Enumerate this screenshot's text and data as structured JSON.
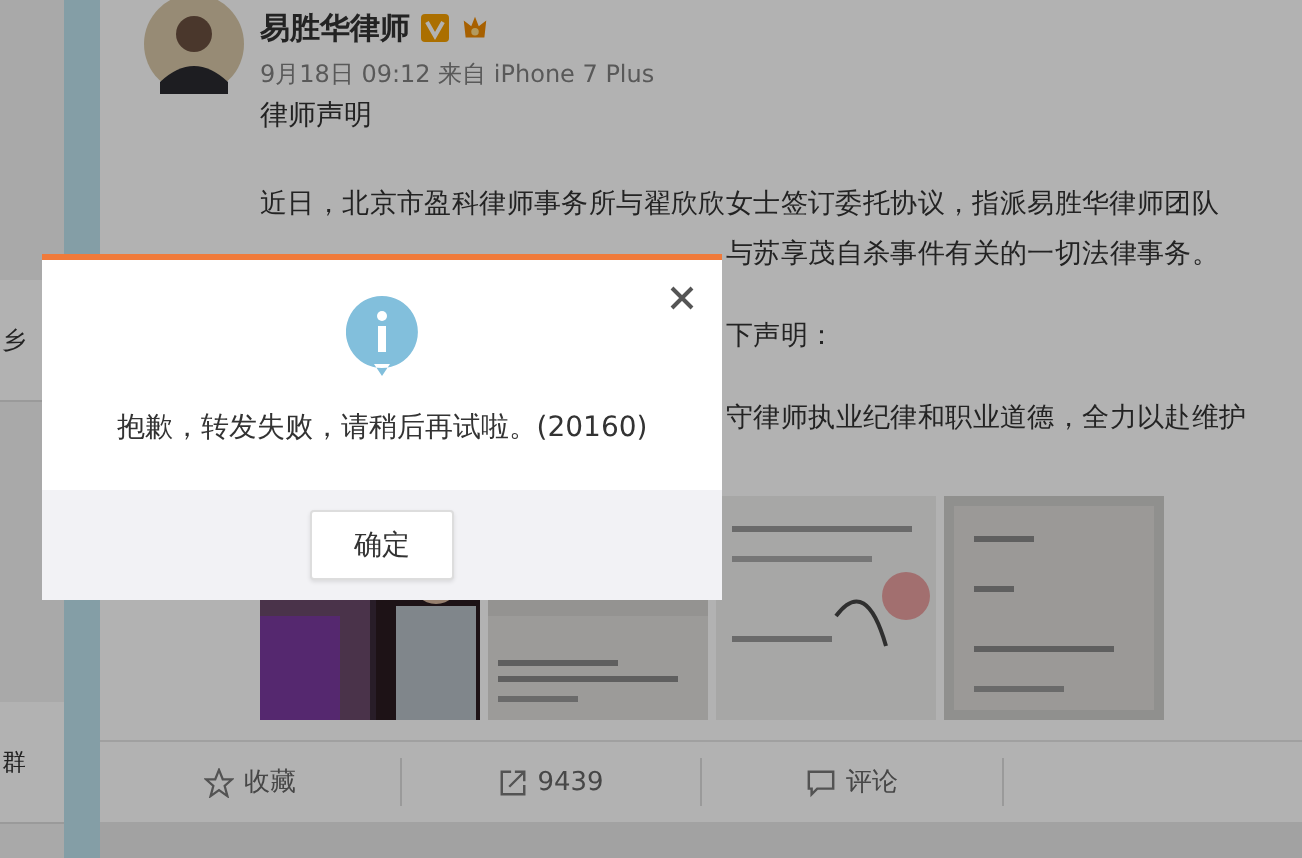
{
  "sidebar": {
    "items": [
      {
        "label": "乡"
      },
      {
        "label": "群"
      }
    ]
  },
  "post": {
    "author": "易胜华律师",
    "meta": "9月18日 09:12 来自 iPhone 7 Plus",
    "title": "律师声明",
    "lines": [
      {
        "text": "近日，北京市盈科律师事务所与翟欣欣女士签订委托协议，指派易胜华律师团队",
        "kind": "full"
      },
      {
        "text": "与苏享茂自杀事件有关的一切法律事务。",
        "kind": "partial"
      },
      {
        "text": "下声明：",
        "kind": "partial"
      },
      {
        "text": "守律师执业纪律和职业道德，全力以赴维护",
        "kind": "partial"
      }
    ]
  },
  "actions": [
    {
      "kind": "favorite",
      "label": "收藏"
    },
    {
      "kind": "repost",
      "label": "9439"
    },
    {
      "kind": "comment",
      "label": "评论"
    }
  ],
  "dialog": {
    "message": "抱歉，转发失败，请稍后再试啦。(20160)",
    "button": "确定"
  }
}
